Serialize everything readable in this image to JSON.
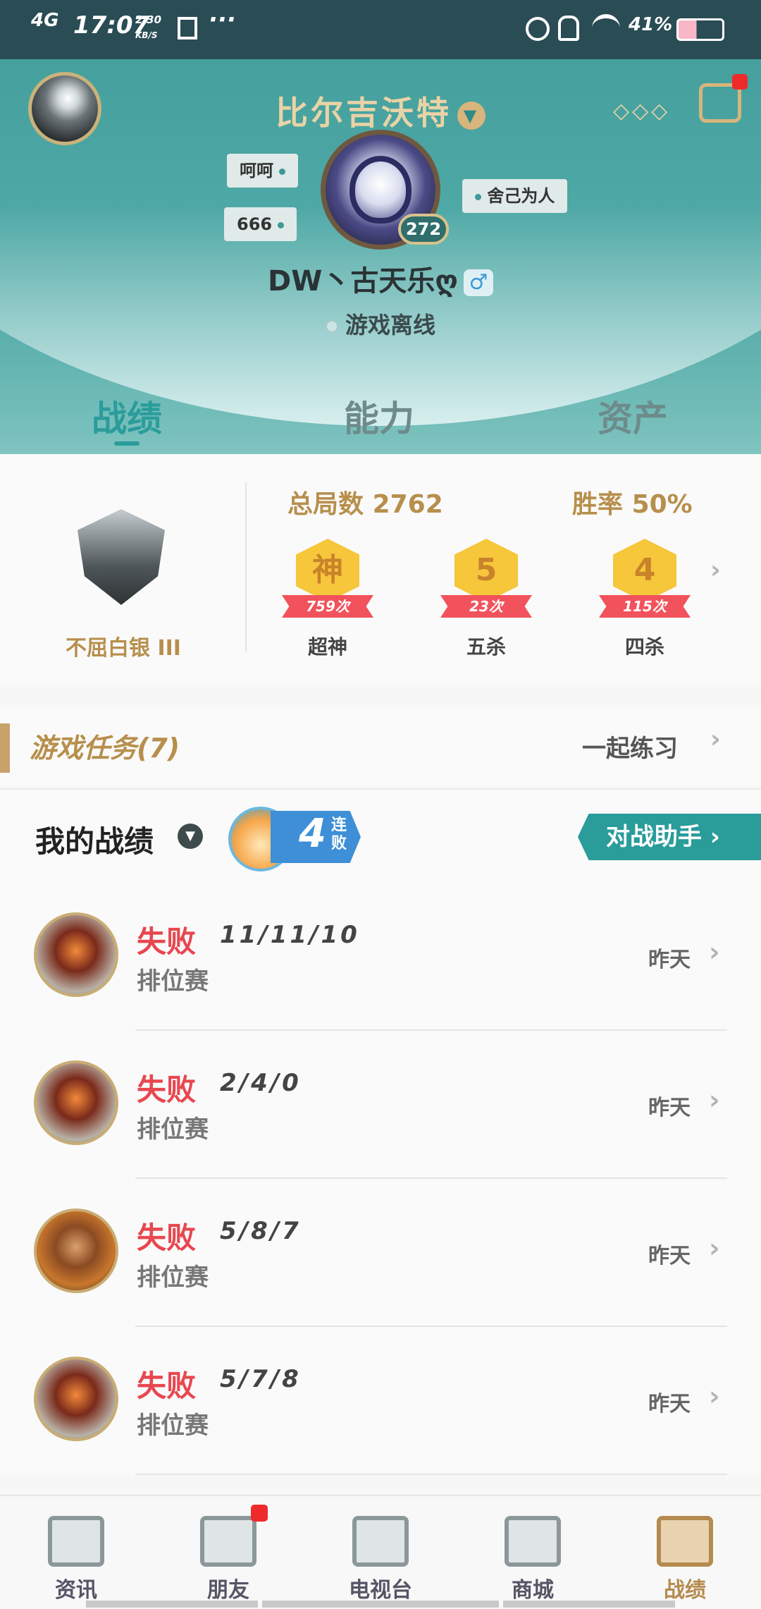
{
  "status_bar": {
    "network": "4G",
    "time": "17:07",
    "speed_value": "2.30",
    "speed_unit": "KB/S",
    "more": "···",
    "battery": "41%"
  },
  "profile": {
    "player_name": "比尔吉沃特",
    "level": "272",
    "tags": [
      "呵呵",
      "666",
      "舍己为人"
    ],
    "nickname": "DW丶古天乐ღ",
    "gender_symbol": "♂",
    "status_text": "游戏离线",
    "more_dots": "◇◇◇"
  },
  "tabs": [
    {
      "label": "战绩",
      "active": true
    },
    {
      "label": "能力",
      "active": false
    },
    {
      "label": "资产",
      "active": false
    }
  ],
  "stats": {
    "rank": "不屈白银 III",
    "total_games_label": "总局数",
    "total_games": "2762",
    "win_rate_label": "胜率",
    "win_rate": "50%",
    "medals": [
      {
        "icon": "神",
        "count": "759次",
        "label": "超神"
      },
      {
        "icon": "5",
        "count": "23次",
        "label": "五杀"
      },
      {
        "icon": "4",
        "count": "115次",
        "label": "四杀"
      }
    ]
  },
  "tasks": {
    "title": "游戏任务(7)",
    "action": "一起练习"
  },
  "my_record": {
    "title": "我的战绩",
    "streak_number": "4",
    "streak_text": "连败",
    "assistant_button": "对战助手"
  },
  "matches": [
    {
      "result": "失败",
      "kda": "11/11/10",
      "mode": "排位赛",
      "time": "昨天",
      "hero": "armored-knight"
    },
    {
      "result": "失败",
      "kda": "2/4/0",
      "mode": "排位赛",
      "time": "昨天",
      "hero": "armored-knight"
    },
    {
      "result": "失败",
      "kda": "5/8/7",
      "mode": "排位赛",
      "time": "昨天",
      "hero": "warrior"
    },
    {
      "result": "失败",
      "kda": "5/7/8",
      "mode": "排位赛",
      "time": "昨天",
      "hero": "armored-knight"
    }
  ],
  "bottom_nav": [
    {
      "label": "资讯",
      "icon": "news-icon",
      "active": false,
      "badge": false
    },
    {
      "label": "朋友",
      "icon": "friends-icon",
      "active": false,
      "badge": true
    },
    {
      "label": "电视台",
      "icon": "tv-icon",
      "active": false,
      "badge": false
    },
    {
      "label": "商城",
      "icon": "shop-icon",
      "active": false,
      "badge": false
    },
    {
      "label": "战绩",
      "icon": "record-icon",
      "active": true,
      "badge": false
    }
  ],
  "colors": {
    "header_teal": "#3d9a98",
    "gold": "#b78f4c",
    "loss_red": "#e8474f",
    "active_tab": "#2b9c9b"
  }
}
